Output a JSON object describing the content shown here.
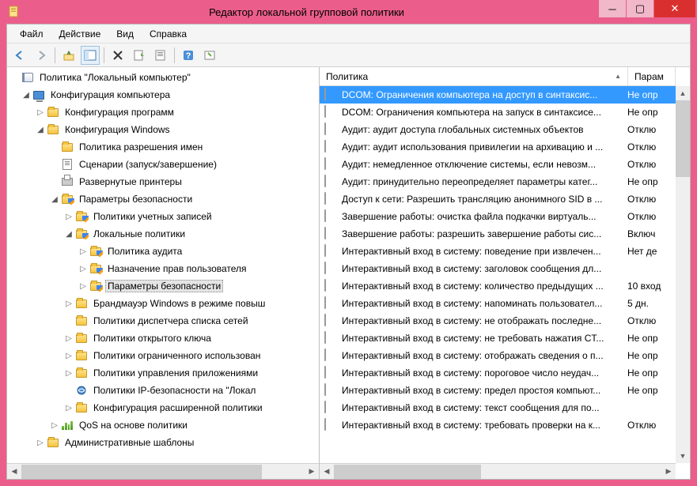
{
  "window": {
    "title": "Редактор локальной групповой политики"
  },
  "menu": {
    "file": "Файл",
    "action": "Действие",
    "view": "Вид",
    "help": "Справка"
  },
  "tree": {
    "root": "Политика \"Локальный компьютер\"",
    "computer_config": "Конфигурация компьютера",
    "prog_config": "Конфигурация программ",
    "win_config": "Конфигурация Windows",
    "name_res": "Политика разрешения имен",
    "scripts": "Сценарии (запуск/завершение)",
    "printers": "Развернутые принтеры",
    "sec_params": "Параметры безопасности",
    "acct_pol": "Политики учетных записей",
    "local_pol": "Локальные политики",
    "audit_pol": "Политика аудита",
    "user_rights": "Назначение прав пользователя",
    "sec_opts": "Параметры безопасности",
    "firewall": "Брандмауэр Windows в режиме повыш",
    "netlist": "Политики диспетчера списка сетей",
    "pubkey": "Политики открытого ключа",
    "restrict": "Политики ограниченного использован",
    "appctrl": "Политики управления приложениями",
    "ipsec": "Политики IP-безопасности на \"Локал",
    "advaudit": "Конфигурация расширенной политики",
    "qos": "QoS на основе политики",
    "admin_tmpl": "Административные шаблоны"
  },
  "list": {
    "header_policy": "Политика",
    "header_param": "Парам",
    "rows": [
      {
        "p": "DCOM: Ограничения компьютера на доступ в синтаксис...",
        "v": "Не опр",
        "sel": true
      },
      {
        "p": "DCOM: Ограничения компьютера на запуск в синтаксисе...",
        "v": "Не опр"
      },
      {
        "p": "Аудит: аудит доступа глобальных системных объектов",
        "v": "Отклю"
      },
      {
        "p": "Аудит: аудит использования привилегии на архивацию и ...",
        "v": "Отклю"
      },
      {
        "p": "Аудит: немедленное отключение системы, если невозм...",
        "v": "Отклю"
      },
      {
        "p": "Аудит: принудительно переопределяет параметры катег...",
        "v": "Не опр"
      },
      {
        "p": "Доступ к сети: Разрешить трансляцию анонимного SID в ...",
        "v": "Отклю"
      },
      {
        "p": "Завершение работы: очистка файла подкачки виртуаль...",
        "v": "Отклю"
      },
      {
        "p": "Завершение работы: разрешить завершение работы сис...",
        "v": "Включ"
      },
      {
        "p": "Интерактивный вход в систему: поведение при извлечен...",
        "v": "Нет де"
      },
      {
        "p": "Интерактивный вход в систему: заголовок сообщения дл...",
        "v": ""
      },
      {
        "p": "Интерактивный вход в систему: количество предыдущих ...",
        "v": "10 вход"
      },
      {
        "p": "Интерактивный вход в систему: напоминать пользовател...",
        "v": "5 дн."
      },
      {
        "p": "Интерактивный вход в систему: не отображать последне...",
        "v": "Отклю"
      },
      {
        "p": "Интерактивный вход в систему: не требовать нажатия CT...",
        "v": "Не опр"
      },
      {
        "p": "Интерактивный вход в систему: отображать сведения о п...",
        "v": "Не опр"
      },
      {
        "p": "Интерактивный вход в систему: пороговое число неудач...",
        "v": "Не опр"
      },
      {
        "p": "Интерактивный вход в систему: предел простоя компьют...",
        "v": "Не опр"
      },
      {
        "p": "Интерактивный вход в систему: текст сообщения для по...",
        "v": ""
      },
      {
        "p": "Интерактивный вход в систему: требовать проверки на к...",
        "v": "Отклю"
      }
    ]
  }
}
